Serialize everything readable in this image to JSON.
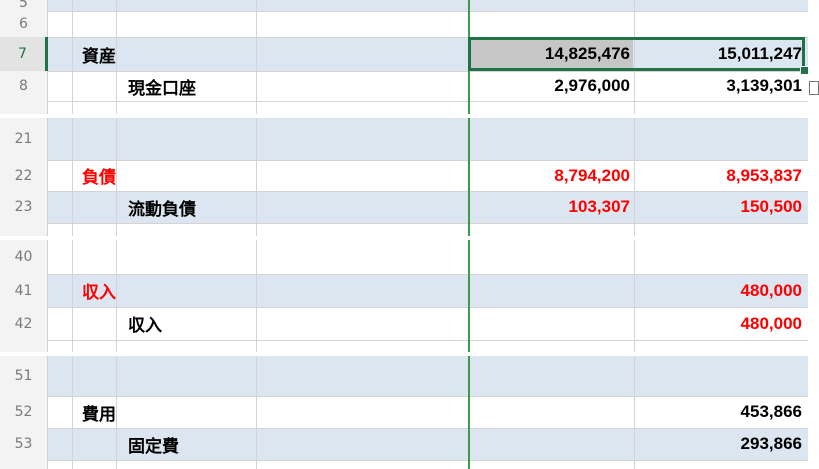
{
  "band1": {
    "rows": [
      {
        "num": "5",
        "label": "",
        "v1": "",
        "v2": "",
        "shaded": true
      },
      {
        "num": "6",
        "label": "",
        "v1": "",
        "v2": "",
        "shaded": false
      },
      {
        "num": "7",
        "label": "資産",
        "v1": "14,825,476",
        "v2": "15,011,247",
        "shaded": true,
        "active": true
      },
      {
        "num": "8",
        "label": "現金口座",
        "v1": "2,976,000",
        "v2": "3,139,301",
        "shaded": false
      }
    ]
  },
  "band2": {
    "rows": [
      {
        "num": "21",
        "label": "",
        "v1": "",
        "v2": "",
        "shaded": false
      },
      {
        "num": "22",
        "label": "負債",
        "v1": "8,794,200",
        "v2": "8,953,837",
        "shaded": false
      },
      {
        "num": "23",
        "label": "流動負債",
        "v1": "103,307",
        "v2": "150,500",
        "shaded": true
      }
    ]
  },
  "band3": {
    "rows": [
      {
        "num": "40",
        "label": "",
        "v1": "",
        "v2": "",
        "shaded": false
      },
      {
        "num": "41",
        "label": "収入",
        "v1": "",
        "v2": "480,000",
        "shaded": true
      },
      {
        "num": "42",
        "label": "収入",
        "v1": "",
        "v2": "480,000",
        "shaded": false
      }
    ]
  },
  "band4": {
    "rows": [
      {
        "num": "51",
        "label": "",
        "v1": "",
        "v2": "",
        "shaded": false
      },
      {
        "num": "52",
        "label": "費用",
        "v1": "",
        "v2": "453,866",
        "shaded": false
      },
      {
        "num": "53",
        "label": "固定費",
        "v1": "",
        "v2": "293,866",
        "shaded": true
      }
    ]
  },
  "colors": {
    "accent_green": "#217346",
    "negative_red": "#ff0000",
    "row_shade": "#dce6f1"
  }
}
